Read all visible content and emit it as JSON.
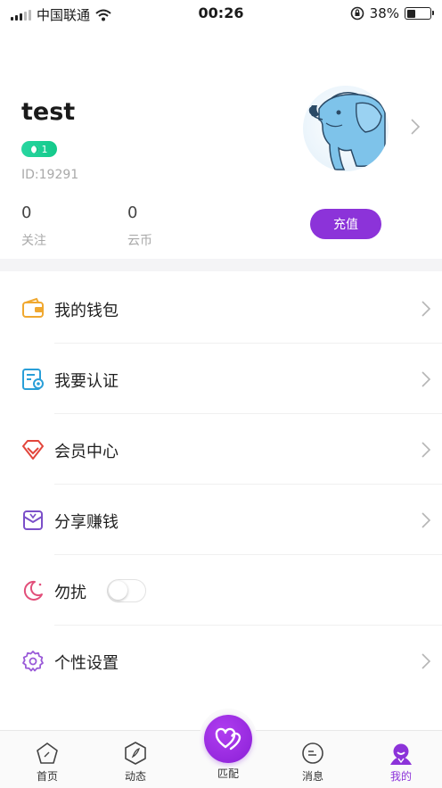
{
  "status_bar": {
    "carrier": "中国联通",
    "time": "00:26",
    "battery": "38%",
    "battery_level": 0.38
  },
  "profile": {
    "username": "test",
    "level": "1",
    "user_id": "ID:19291",
    "stats": [
      {
        "value": "0",
        "label": "关注"
      },
      {
        "value": "0",
        "label": "云币"
      }
    ],
    "recharge_label": "充值"
  },
  "menu": [
    {
      "label": "我的钱包",
      "icon": "wallet-icon"
    },
    {
      "label": "我要认证",
      "icon": "verify-icon"
    },
    {
      "label": "会员中心",
      "icon": "diamond-icon"
    },
    {
      "label": "分享赚钱",
      "icon": "share-money-icon"
    },
    {
      "label": "勿扰",
      "icon": "moon-icon",
      "toggle_on": false
    },
    {
      "label": "个性设置",
      "icon": "gear-icon"
    }
  ],
  "tabs": [
    {
      "label": "首页",
      "icon": "home-icon"
    },
    {
      "label": "动态",
      "icon": "feed-icon"
    },
    {
      "label": "匹配",
      "icon": "heart-match-icon"
    },
    {
      "label": "消息",
      "icon": "message-icon"
    },
    {
      "label": "我的",
      "icon": "profile-icon",
      "active": true
    }
  ],
  "colors": {
    "accent": "#8c33d9",
    "level_badge": "#1bc98d",
    "wallet": "#f0a830",
    "verify": "#2a9fd8",
    "diamond": "#e2453b",
    "share": "#7b4fc9",
    "moon": "#e24f7a",
    "gear": "#9a5ad8"
  }
}
